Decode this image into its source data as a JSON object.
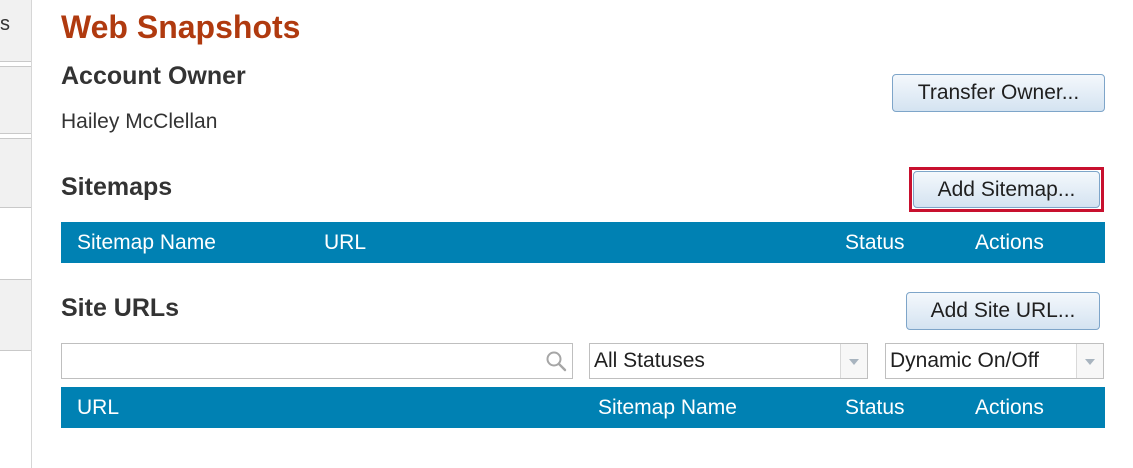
{
  "left_rail": {
    "tab1_text": "s"
  },
  "page": {
    "title": "Web Snapshots"
  },
  "account_owner": {
    "heading": "Account Owner",
    "name": "Hailey McClellan",
    "transfer_button": "Transfer Owner..."
  },
  "sitemaps": {
    "heading": "Sitemaps",
    "add_button": "Add Sitemap...",
    "columns": [
      "Sitemap Name",
      "URL",
      "Status",
      "Actions"
    ],
    "rows": []
  },
  "site_urls": {
    "heading": "Site URLs",
    "add_button": "Add Site URL...",
    "search": {
      "value": "",
      "placeholder": ""
    },
    "status_filter": {
      "selected": "All Statuses"
    },
    "dynamic_filter": {
      "selected": "Dynamic On/Off"
    },
    "columns": [
      "URL",
      "Sitemap Name",
      "Status",
      "Actions"
    ],
    "rows": []
  },
  "colors": {
    "title": "#b03a0f",
    "table_header": "#0081b3",
    "highlight": "#c8102e"
  },
  "icons": {
    "search": "search-icon",
    "dropdown": "chevron-down-icon"
  }
}
